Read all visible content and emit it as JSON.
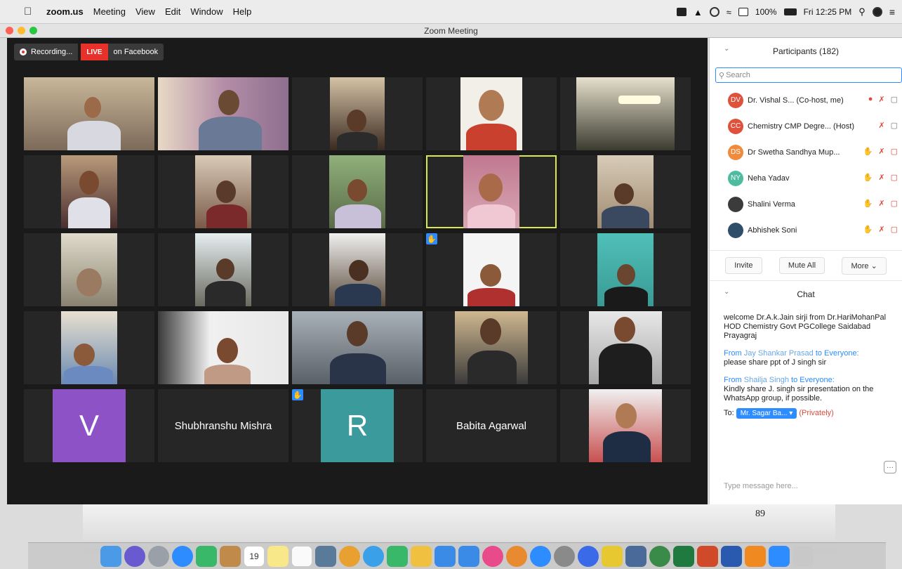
{
  "menubar": {
    "app": "zoom.us",
    "items": [
      "Meeting",
      "View",
      "Edit",
      "Window",
      "Help"
    ],
    "battery": "100%",
    "clock": "Fri 12:25 PM"
  },
  "window": {
    "title": "Zoom Meeting"
  },
  "recording": {
    "label": "Recording...",
    "live": "LIVE",
    "stream": "on Facebook"
  },
  "tiles": {
    "avatar_v": "V",
    "name_1": "Shubhranshu Mishra",
    "avatar_r": "R",
    "name_2": "Babita Agarwal"
  },
  "colors": {
    "accent": "#2d8cff",
    "live": "#e8312a",
    "avatar_v": "#8c52c6",
    "avatar_r": "#3a9a9c",
    "active_border": "#d9e84a"
  },
  "participants": {
    "header": "Participants (182)",
    "search_placeholder": "Search",
    "list": [
      {
        "initials": "DV",
        "name": "Dr. Vishal S... (Co-host, me)",
        "color": "#e0513b"
      },
      {
        "initials": "CC",
        "name": "Chemistry CMP Degre... (Host)",
        "color": "#e0513b"
      },
      {
        "initials": "DS",
        "name": "Dr Swetha Sandhya Mup...",
        "color": "#f08a3c"
      },
      {
        "initials": "NY",
        "name": "Neha Yadav",
        "color": "#4dbba0"
      },
      {
        "initials": "",
        "name": "Shalini Verma",
        "color": "#3b3b3b"
      },
      {
        "initials": "",
        "name": "Abhishek Soni",
        "color": "#2f4e6a"
      }
    ],
    "buttons": {
      "invite": "Invite",
      "mute_all": "Mute All",
      "more": "More ⌄"
    }
  },
  "chat": {
    "header": "Chat",
    "msg1": "welcome Dr.A.k.Jain sirji from Dr.HariMohanPal HOD Chemistry Govt PGCollege Saidabad Prayagraj",
    "from2_prefix": "From",
    "from2_name": "Jay Shankar Prasad",
    "from2_suffix": "to Everyone:",
    "msg2": "please share ppt of J singh sir",
    "from3_prefix": "From",
    "from3_name": "Shailja Singh",
    "from3_suffix": "to Everyone:",
    "msg3": "Kindly share J. singh sir presentation on the WhatsApp group, if possible.",
    "to_label": "To:",
    "to_target": "Mr. Sagar Ba... ▾",
    "privately": "(Privately)",
    "more": "···",
    "input_placeholder": "Type message here..."
  },
  "slide": {
    "page": "89"
  },
  "dock": {
    "calendar_day": "19"
  }
}
